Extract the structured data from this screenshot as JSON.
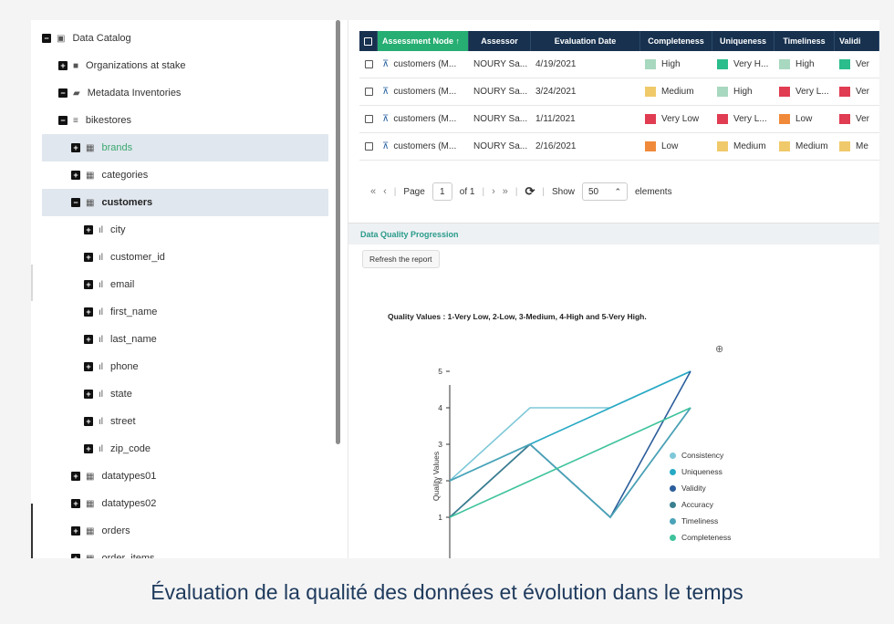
{
  "tree": {
    "items": [
      {
        "label": "Data Catalog",
        "toggle": "−",
        "icon": "catalog-icon",
        "glyph": "▣",
        "level": 0
      },
      {
        "label": "Organizations at stake",
        "toggle": "+",
        "icon": "folder-icon",
        "glyph": "■",
        "level": 1
      },
      {
        "label": "Metadata Inventories",
        "toggle": "−",
        "icon": "folder-open-icon",
        "glyph": "▰",
        "level": 1
      },
      {
        "label": "bikestores",
        "toggle": "−",
        "icon": "database-icon",
        "glyph": "≡",
        "level": 2
      },
      {
        "label": "brands",
        "toggle": "+",
        "icon": "table-icon",
        "glyph": "▦",
        "level": 3
      },
      {
        "label": "categories",
        "toggle": "+",
        "icon": "table-icon",
        "glyph": "▦",
        "level": 3
      },
      {
        "label": "customers",
        "toggle": "−",
        "icon": "table-icon",
        "glyph": "▦",
        "level": 3
      },
      {
        "label": "city",
        "toggle": "+",
        "icon": "column-icon",
        "glyph": "ıl",
        "level": 4
      },
      {
        "label": "customer_id",
        "toggle": "+",
        "icon": "column-icon",
        "glyph": "ıl",
        "level": 4
      },
      {
        "label": "email",
        "toggle": "+",
        "icon": "column-icon",
        "glyph": "ıl",
        "level": 4
      },
      {
        "label": "first_name",
        "toggle": "+",
        "icon": "column-icon",
        "glyph": "ıl",
        "level": 4
      },
      {
        "label": "last_name",
        "toggle": "+",
        "icon": "column-icon",
        "glyph": "ıl",
        "level": 4
      },
      {
        "label": "phone",
        "toggle": "+",
        "icon": "column-icon",
        "glyph": "ıl",
        "level": 4
      },
      {
        "label": "state",
        "toggle": "+",
        "icon": "column-icon",
        "glyph": "ıl",
        "level": 4
      },
      {
        "label": "street",
        "toggle": "+",
        "icon": "column-icon",
        "glyph": "ıl",
        "level": 4
      },
      {
        "label": "zip_code",
        "toggle": "+",
        "icon": "column-icon",
        "glyph": "ıl",
        "level": 4
      },
      {
        "label": "datatypes01",
        "toggle": "+",
        "icon": "table-icon",
        "glyph": "▦",
        "level": 3
      },
      {
        "label": "datatypes02",
        "toggle": "+",
        "icon": "table-icon",
        "glyph": "▦",
        "level": 3
      },
      {
        "label": "orders",
        "toggle": "+",
        "icon": "table-icon",
        "glyph": "▦",
        "level": 3
      },
      {
        "label": "order_items",
        "toggle": "+",
        "icon": "table-icon",
        "glyph": "▦",
        "level": 3
      }
    ]
  },
  "grid": {
    "headers": [
      "Assessment Node ↑",
      "Assessor",
      "Evaluation Date",
      "Completeness",
      "Uniqueness",
      "Timeliness",
      "Validi"
    ],
    "rows": [
      {
        "node": "customers (M...",
        "assessor": "NOURY Sa...",
        "date": "4/19/2021",
        "q": [
          {
            "t": "High",
            "c": "#a8d8bf"
          },
          {
            "t": "Very H...",
            "c": "#2bbd8c"
          },
          {
            "t": "High",
            "c": "#a8d8bf"
          },
          {
            "t": "Ver",
            "c": "#2bbd8c"
          }
        ]
      },
      {
        "node": "customers (M...",
        "assessor": "NOURY Sa...",
        "date": "3/24/2021",
        "q": [
          {
            "t": "Medium",
            "c": "#f0c96a"
          },
          {
            "t": "High",
            "c": "#a8d8bf"
          },
          {
            "t": "Very L...",
            "c": "#e03c52"
          },
          {
            "t": "Ver",
            "c": "#e03c52"
          }
        ]
      },
      {
        "node": "customers (M...",
        "assessor": "NOURY Sa...",
        "date": "1/11/2021",
        "q": [
          {
            "t": "Very Low",
            "c": "#e03c52"
          },
          {
            "t": "Very L...",
            "c": "#e03c52"
          },
          {
            "t": "Low",
            "c": "#f08a3a"
          },
          {
            "t": "Ver",
            "c": "#e03c52"
          }
        ]
      },
      {
        "node": "customers (M...",
        "assessor": "NOURY Sa...",
        "date": "2/16/2021",
        "q": [
          {
            "t": "Low",
            "c": "#f08a3a"
          },
          {
            "t": "Medium",
            "c": "#f0c96a"
          },
          {
            "t": "Medium",
            "c": "#f0c96a"
          },
          {
            "t": "Me",
            "c": "#f0c96a"
          }
        ]
      }
    ]
  },
  "pager": {
    "first": "«",
    "prev": "‹",
    "page_label": "Page",
    "page_value": "1",
    "of_label": "of 1",
    "next": "›",
    "last": "»",
    "show_label": "Show",
    "page_size": "50",
    "elements_label": "elements"
  },
  "section": {
    "title": "Data Quality Progression",
    "refresh_label": "Refresh the report"
  },
  "chart_data": {
    "type": "line",
    "title": "Quality Values : 1-Very Low, 2-Low, 3-Medium, 4-High and 5-Very High.",
    "ylabel": "Quality Values",
    "xlabel": "",
    "ylim": [
      0,
      5
    ],
    "yticks": [
      1,
      2,
      3,
      4,
      5
    ],
    "x": [
      1,
      2,
      3,
      4
    ],
    "series": [
      {
        "name": "Consistency",
        "color": "#7ec8d8",
        "values": [
          2,
          4,
          4,
          5
        ]
      },
      {
        "name": "Uniqueness",
        "color": "#27a9c4",
        "values": [
          2,
          3,
          4,
          5
        ]
      },
      {
        "name": "Validity",
        "color": "#2b5d9b",
        "values": [
          1,
          3,
          1,
          5
        ]
      },
      {
        "name": "Accuracy",
        "color": "#3a7f8f",
        "values": [
          1,
          3,
          1,
          4
        ]
      },
      {
        "name": "Timeliness",
        "color": "#4aa3b8",
        "values": [
          2,
          3,
          1,
          4
        ]
      },
      {
        "name": "Completeness",
        "color": "#3ec39c",
        "values": [
          1,
          2,
          3,
          4
        ]
      }
    ],
    "legend_position": "right"
  },
  "caption": "Évaluation de la qualité des données et évolution dans le temps"
}
